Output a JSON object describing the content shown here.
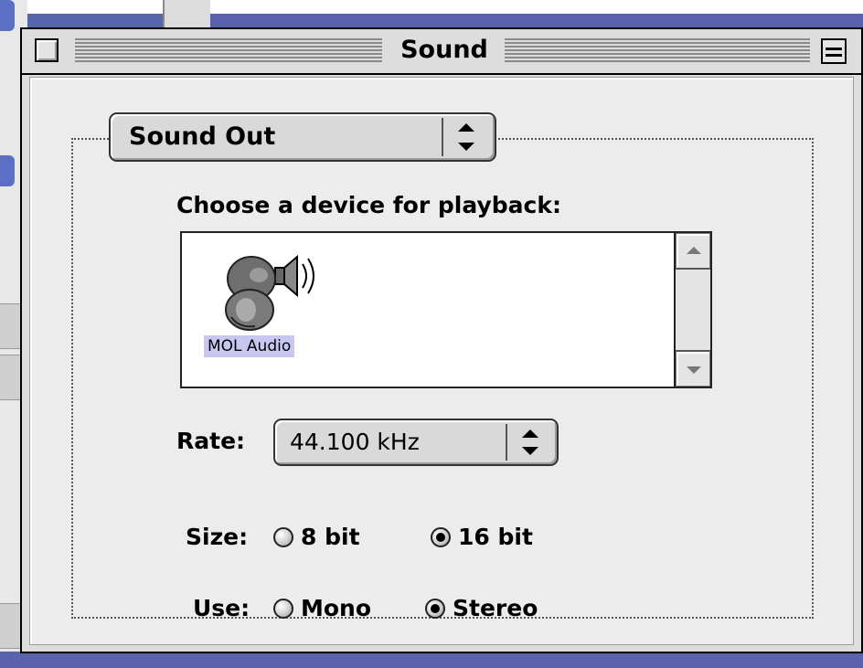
{
  "window": {
    "title": "Sound"
  },
  "panel": {
    "section_popup": "Sound Out"
  },
  "device_list": {
    "prompt": "Choose a device for playback:",
    "items": [
      {
        "label": "MOL Audio",
        "selected": true,
        "icon": "speaker-device-icon"
      }
    ]
  },
  "rate": {
    "label": "Rate:",
    "value": "44.100 kHz"
  },
  "size": {
    "label": "Size:",
    "options": [
      {
        "label": "8 bit",
        "checked": false
      },
      {
        "label": "16 bit",
        "checked": true
      }
    ]
  },
  "use": {
    "label": "Use:",
    "options": [
      {
        "label": "Mono",
        "checked": false
      },
      {
        "label": "Stereo",
        "checked": true
      }
    ]
  },
  "colors": {
    "desktop": "#5a62ad",
    "window": "#dddddd",
    "panel": "#ececec",
    "selection": "#c7c7f2"
  }
}
